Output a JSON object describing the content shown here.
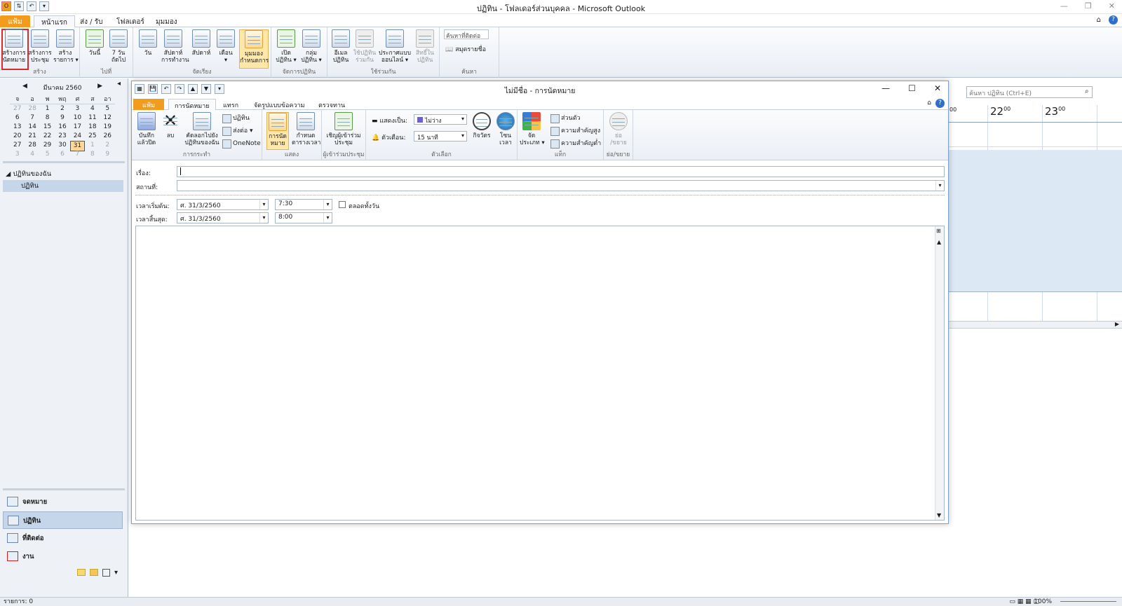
{
  "outer": {
    "title": "ปฏิทิน - โฟลเดอร์ส่วนบุคคล - Microsoft Outlook",
    "tabs": [
      "แฟ้ม",
      "หน้าแรก",
      "ส่ง / รับ",
      "โฟลเดอร์",
      "มุมมอง"
    ],
    "ribbon": {
      "new_appt": "สร้างการ\nนัดหมาย",
      "new_meeting": "สร้างการ\nประชุม",
      "new_items": "สร้าง\nรายการ ▾",
      "group_new": "สร้าง",
      "today": "วันนี้",
      "next7": "7 วัน\nถัดไป",
      "group_goto": "ไปที่",
      "day": "วัน",
      "workweek": "สัปดาห์\nการทำงาน",
      "week": "สัปดาห์",
      "month": "เดือน\n▾",
      "schedule": "มุมมอง\nกำหนดการ",
      "group_arrange": "จัดเรียง",
      "open_cal": "เปิด\nปฏิทิน ▾",
      "cal_groups": "กลุ่ม\nปฏิทิน ▾",
      "group_manage": "จัดการปฏิทิน",
      "email_cal": "อีเมล\nปฏิทิน",
      "share_cal": "ใช้ปฏิทิน\nร่วมกัน",
      "publish": "ประกาศแบบ\nออนไลน์ ▾",
      "permissions": "สิทธิ์ใน\nปฏิทิน",
      "group_share": "ใช้ร่วมกัน",
      "find_contact": "ค้นหาที่ติดต่อ",
      "address_book": "สมุดรายชื่อ",
      "group_find": "ค้นหา"
    }
  },
  "minical": {
    "month": "มีนาคม 2560",
    "days": [
      "จ",
      "อ",
      "พ",
      "พฤ",
      "ศ",
      "ส",
      "อา"
    ],
    "weeks": [
      [
        "27",
        "28",
        "1",
        "2",
        "3",
        "4",
        "5"
      ],
      [
        "6",
        "7",
        "8",
        "9",
        "10",
        "11",
        "12"
      ],
      [
        "13",
        "14",
        "15",
        "16",
        "17",
        "18",
        "19"
      ],
      [
        "20",
        "21",
        "22",
        "23",
        "24",
        "25",
        "26"
      ],
      [
        "27",
        "28",
        "29",
        "30",
        "31",
        "1",
        "2"
      ],
      [
        "3",
        "4",
        "5",
        "6",
        "7",
        "8",
        "9"
      ]
    ]
  },
  "tree": {
    "group": "ปฏิทินของฉัน",
    "item": "ปฏิทิน"
  },
  "nav": [
    "จดหมาย",
    "ปฏิทิน",
    "ที่ติดต่อ",
    "งาน"
  ],
  "calview": {
    "search_placeholder": "ค้นหา ปฏิทิน (Ctrl+E)",
    "hour1": "22",
    "hour2": "23",
    "hour_partial": "00",
    "sup": "00"
  },
  "status": {
    "items": "รายการ: 0",
    "zoom": "100%"
  },
  "appt": {
    "title": "ไม่มีชื่อ - การนัดหมาย",
    "tabs": [
      "แฟ้ม",
      "การนัดหมาย",
      "แทรก",
      "จัดรูปแบบข้อความ",
      "ตรวจทาน"
    ],
    "ribbon": {
      "save_close": "บันทึก\nแล้วปิด",
      "delete": "ลบ",
      "copy_to": "คัดลอกไปยัง\nปฏิทินของฉัน",
      "calendar": "ปฏิทิน",
      "forward": "ส่งต่อ ▾",
      "onenote": "OneNote",
      "group_actions": "การกระทำ",
      "appointment": "การนัด\nหมาย",
      "scheduling": "กำหนด\nตารางเวลา",
      "group_show": "แสดง",
      "invite": "เชิญผู้เข้าร่วม\nประชุม",
      "group_attendees": "ผู้เข้าร่วมประชุม",
      "show_as": "แสดงเป็น:",
      "show_as_val": "ไม่ว่าง",
      "reminder": "ตัวเตือน:",
      "reminder_val": "15 นาที",
      "recurrence": "กิจวัตร",
      "timezone": "โซน\nเวลา",
      "group_options": "ตัวเลือก",
      "categorize": "จัด\nประเภท ▾",
      "private": "ส่วนตัว",
      "high": "ความสำคัญสูง",
      "low": "ความสำคัญต่ำ",
      "group_tags": "แท็ก",
      "zoom": "ย่อ\n/ขยาย",
      "group_zoom": "ย่อ/ขยาย"
    },
    "subject_label": "เรื่อง:",
    "location_label": "สถานที่:",
    "start_label": "เวลาเริ่มต้น:",
    "end_label": "เวลาสิ้นสุด:",
    "start_date": "ศ. 31/3/2560",
    "start_time": "7:30",
    "end_date": "ศ. 31/3/2560",
    "end_time": "8:00",
    "allday": "ตลอดทั้งวัน"
  },
  "colors": {
    "file_tab": "#f29c1d",
    "highlight": "#d92b2b",
    "selected": "#ffd891"
  }
}
